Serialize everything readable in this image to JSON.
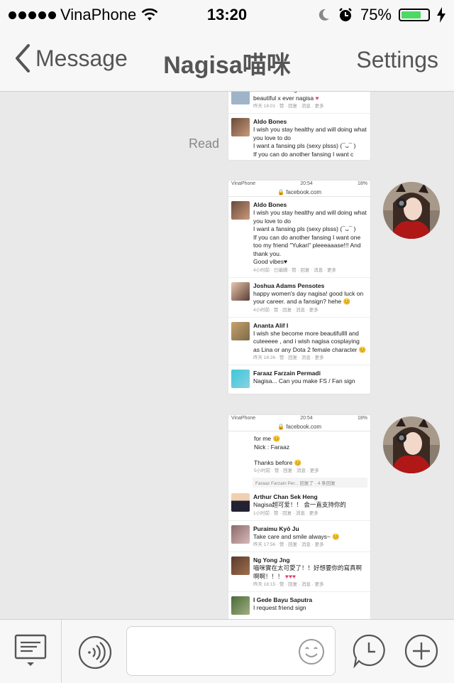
{
  "status": {
    "carrier": "VinaPhone",
    "time": "13:20",
    "battery_pct": "75%",
    "battery_level": 0.75,
    "icons": [
      "signal-dots",
      "wifi-icon",
      "moon-icon",
      "alarm-icon",
      "battery-icon",
      "charging-bolt-icon"
    ]
  },
  "nav": {
    "back_label": "Message",
    "title": "Nagisa喵咪",
    "settings_label": "Settings"
  },
  "chat": {
    "read_label": "Read",
    "shot1": {
      "comments": [
        {
          "name": "",
          "text": "i want some nagisa kisses lol. Just as beautiful x ever nagisa",
          "meta": "昨天 18:01 · 赞 · 回复 · 消息 · 更多"
        },
        {
          "name": "Aldo Bones",
          "text": "I wish you stay healthy and will doing what you love to do",
          "text2": "I want a fansing pls (sexy plsss) (¯ᴗ¯ )",
          "text3": "If you can do another fansing I want c",
          "meta": ""
        }
      ]
    },
    "shot2": {
      "status_left": "VinaPhone",
      "status_time": "20:54",
      "status_right": "18%",
      "url": "facebook.com",
      "comments": [
        {
          "name": "Aldo Bones",
          "text": "I wish you stay healthy and will doing what you love to do",
          "text2": "I want a fansing pls (sexy plsss) (¯ᴗ¯ )",
          "text3": "If you can do another fansing I want one too my friend \"Yukari\" pleeeaaase!!! And thank you.",
          "text4": "Good vibes♥",
          "meta": "4小时前 · 已编辑 · 赞 · 回复 · 消息 · 更多"
        },
        {
          "name": "Joshua Adams Pensotes",
          "text": "happy women's day nagisa! good luck on your career. and a fansign? hehe 😊",
          "meta": "4小时前 · 赞 · 回复 · 消息 · 更多"
        },
        {
          "name": "Ananta Alif I",
          "text": "I wish she become more beautifullll and cuteeeee , and i wish nagisa cosplaying as Lina or any Dota 2 female character 😊",
          "meta": "昨天 18:26 · 赞 · 回复 · 消息 · 更多"
        },
        {
          "name": "Faraaz Farzain Permadi",
          "text": "Nagisa... Can you make FS / Fan sign",
          "meta": ""
        }
      ]
    },
    "shot3": {
      "status_left": "VinaPhone",
      "status_time": "20:54",
      "status_right": "18%",
      "url": "facebook.com",
      "top_text": "for me 😊",
      "top_text2": "Nick : Faraaz",
      "top_text3": "Thanks before 😊",
      "top_meta": "5小时前 · 赞 · 回复 · 消息 · 更多",
      "reply_text": "Faraaz Farzain Per... 回复了 · 4 条回复",
      "comments": [
        {
          "name": "Arthur Chan Sek Heng",
          "text": "Nagisa超可爱！！ 会一直支持你的",
          "meta": "1小时前 · 赞 · 回复 · 消息 · 更多"
        },
        {
          "name": "Puraimu Kyō Ju",
          "text": "Take care and smile always~ 😊",
          "meta": "昨天 17:56 · 赞 · 回复 · 消息 · 更多"
        },
        {
          "name": "Ng Yong Jng",
          "text": "喵咪實在太可愛了！！好想要你的寫真啊啊啊！！！",
          "hearts": "♥♥♥",
          "meta": "昨天 18:15 · 赞 · 回复 · 消息 · 更多"
        },
        {
          "name": "I Gede Bayu Saputra",
          "text": "I request friend sign",
          "meta": ""
        }
      ]
    }
  },
  "toolbar": {
    "icons": [
      "keyboard-menu-icon",
      "voice-icon",
      "emoji-icon",
      "history-icon",
      "plus-icon"
    ],
    "input_value": ""
  }
}
